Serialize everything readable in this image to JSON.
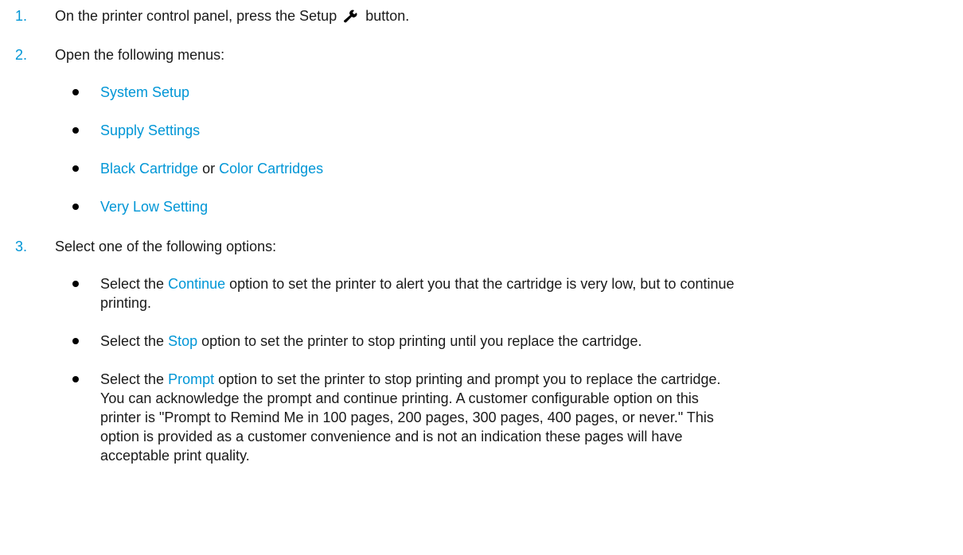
{
  "steps": [
    {
      "number": "1.",
      "text_before": "On the printer control panel, press the Setup",
      "text_after": "button.",
      "icon": "wrench-icon"
    },
    {
      "number": "2.",
      "text": "Open the following menus:",
      "menus": [
        "System Setup",
        "Supply Settings",
        "Black Cartridge",
        "or",
        "Color Cartridges",
        "Very Low Setting"
      ]
    },
    {
      "number": "3.",
      "text": "Select one of the following options:",
      "options": [
        {
          "prefix": "Select the",
          "option": "Continue",
          "line1": "option to set the printer to alert you that the cartridge is very low, but to continue",
          "line2": "printing."
        },
        {
          "prefix": "Select the",
          "option": "Stop",
          "line1": "option to set the printer to stop printing until you replace the cartridge."
        },
        {
          "prefix": "Select the",
          "option": "Prompt",
          "line1": "option to set the printer to stop printing and prompt you to replace the cartridge.",
          "line2": "You can acknowledge the prompt and continue printing. A customer configurable option on this",
          "line3": "printer is \"Prompt to Remind Me in 100 pages, 200 pages, 300 pages, 400 pages, or never.\" This",
          "line4": "option is provided as a customer convenience and is not an indication these pages will have",
          "line5": "acceptable print quality."
        }
      ]
    }
  ],
  "colors": {
    "accent": "#0096d6",
    "text": "#1a1a1a"
  }
}
